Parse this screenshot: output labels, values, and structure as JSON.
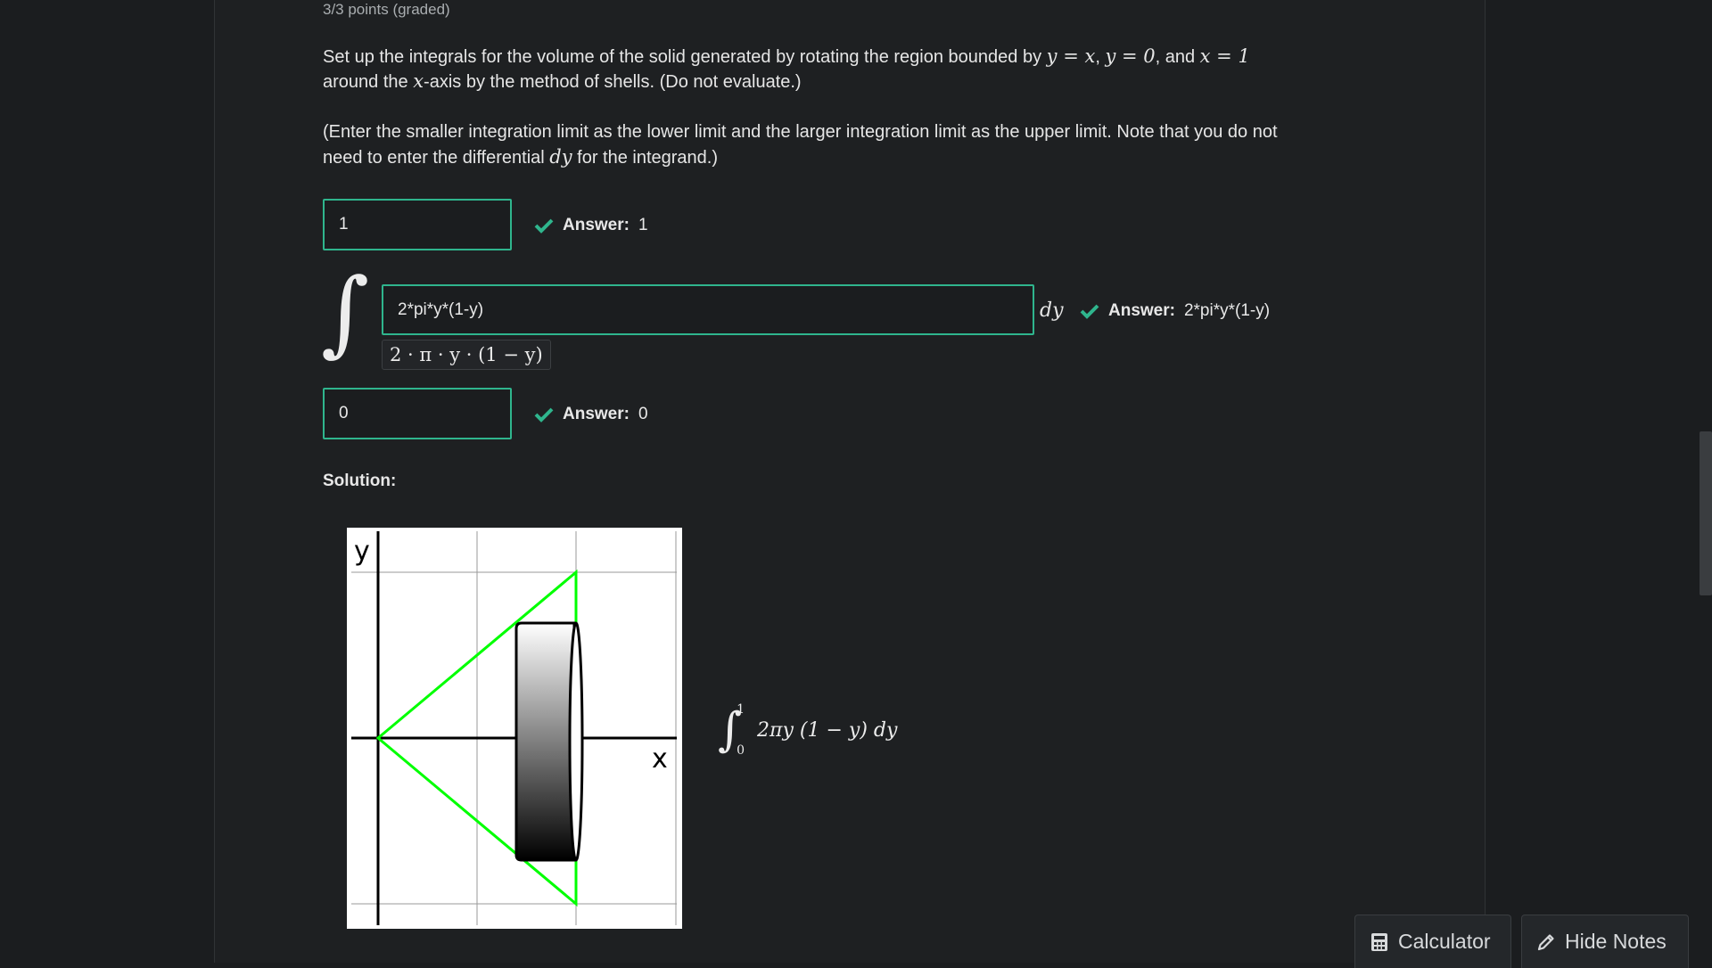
{
  "problem": {
    "points": "3/3 points (graded)",
    "q_a": "Set up the integrals for the volume of the solid generated by rotating the region bounded by ",
    "eq1": "y = x",
    "eq2": "y = 0",
    "q_and": ", and ",
    "eq3": "x = 1",
    "q_b": "around the ",
    "axis_var": "x",
    "q_c": "-axis by the method of shells. (Do not evaluate.)",
    "note_a": "(Enter the smaller integration limit as the lower limit and the larger integration limit as the upper limit. Note that you do not",
    "note_b": "need to enter the differential ",
    "note_dy": "dy",
    "note_c": " for the integrand.)"
  },
  "inputs": {
    "upper_limit": {
      "value": "1",
      "answer_label": "Answer:",
      "answer_value": "1"
    },
    "integrand": {
      "value": "2*pi*y*(1-y)",
      "preview": "2 · π · y · (1 − y)",
      "differential": "dy",
      "answer_label": "Answer:",
      "answer_value": "2*pi*y*(1-y)"
    },
    "lower_limit": {
      "value": "0",
      "answer_label": "Answer:",
      "answer_value": "0"
    }
  },
  "solution": {
    "title": "Solution:",
    "figure": {
      "y_axis_label": "y",
      "x_axis_label": "x"
    },
    "formula": {
      "upper": "1",
      "lower": "0",
      "body": "2πy (1 − y) dy"
    }
  },
  "footer": {
    "calculator_label": "Calculator",
    "notes_label": "Hide Notes"
  },
  "colors": {
    "correct_border": "#2fb58d",
    "check": "#2fb58d",
    "region_outline": "#00ff00",
    "background": "#1b1d1f"
  },
  "icons": [
    "check-icon",
    "calculator-icon",
    "pencil-icon"
  ]
}
